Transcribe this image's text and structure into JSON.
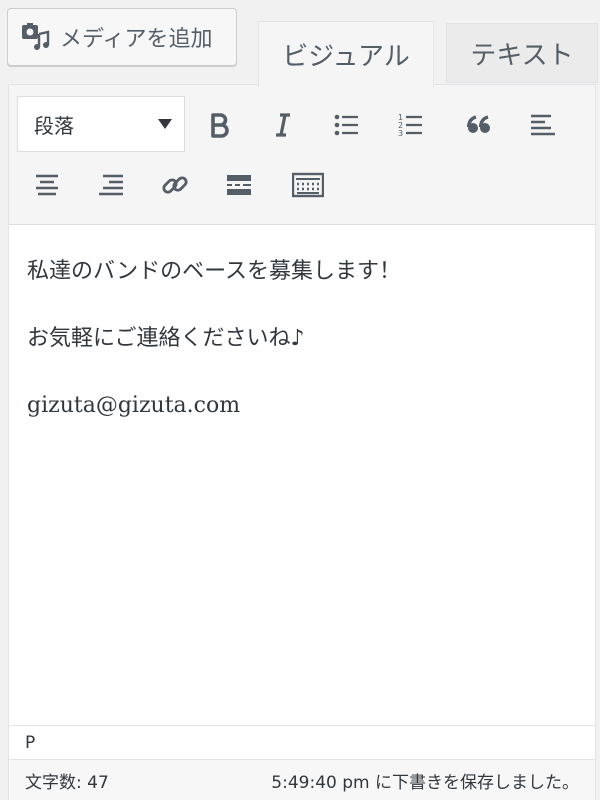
{
  "media_button": {
    "label": "メディアを追加",
    "icon": "add-media-icon"
  },
  "tabs": {
    "visual": "ビジュアル",
    "text": "テキスト",
    "active": "visual"
  },
  "toolbar": {
    "format_select": "段落",
    "buttons": [
      "bold",
      "italic",
      "bulleted-list",
      "numbered-list",
      "blockquote",
      "align-left",
      "align-center",
      "align-right",
      "insert-link",
      "read-more",
      "toolbar-toggle"
    ]
  },
  "content": {
    "paragraphs": [
      "私達のバンドのベースを募集します！",
      "お気軽にご連絡くださいね♪",
      "gizuta@gizuta.com"
    ]
  },
  "path": "P",
  "status": {
    "word_count": "文字数: 47",
    "saved": "5:49:40 pm に下書きを保存しました。"
  },
  "colors": {
    "icon": "#555d66",
    "text": "#32373c",
    "border": "#e2e4e7"
  }
}
